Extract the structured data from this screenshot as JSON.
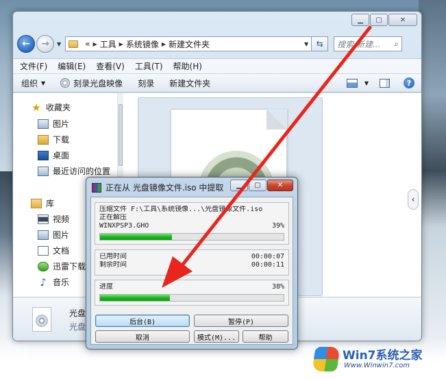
{
  "explorer": {
    "nav": {
      "breadcrumb": [
        "«",
        "工具",
        "系统镜像",
        "新建文件夹"
      ],
      "search_placeholder": "搜索 新建..."
    },
    "menu": [
      "文件(F)",
      "编辑(E)",
      "查看(V)",
      "工具(T)",
      "帮助(H)"
    ],
    "toolbar": {
      "organize": "组织",
      "burn": "刻录光盘映像",
      "burn2": "刻录",
      "new_folder": "新建文件夹"
    },
    "sidebar": {
      "favorites": "收藏夹",
      "fav_items": [
        "图片",
        "下载",
        "桌面",
        "最近访问的位置"
      ],
      "libraries": "库",
      "lib_items": [
        "视频",
        "图片",
        "文档",
        "迅雷下载",
        "音乐"
      ]
    },
    "details": {
      "name": "光盘",
      "type": "光盘"
    }
  },
  "dialog": {
    "title": "正在从 光盘镜像文件.iso 中提取",
    "archive_label": "压缩文件 F:\\工具\\系统镜像...\\光盘镜像文件.iso",
    "status": "正在解压",
    "current_file": "WINXPSP3.GHO",
    "file_percent": "39%",
    "file_progress": 0.39,
    "elapsed_label": "已用时间",
    "elapsed_value": "00:00:07",
    "remaining_label": "剩余时间",
    "remaining_value": "00:00:11",
    "total_label": "进度",
    "total_percent": "38%",
    "total_progress": 0.38,
    "buttons": {
      "background": "后台(B)",
      "pause": "暂停(P)",
      "cancel": "取消",
      "mode": "模式(M)...",
      "help": "帮助"
    }
  },
  "watermark": {
    "brand": "Win7系统之家",
    "url": "Www.Winwin7.com"
  },
  "colors": {
    "progress_green": "#18b81e",
    "annotation_red": "#e8261d",
    "dialog_close_red": "#c9462f"
  }
}
